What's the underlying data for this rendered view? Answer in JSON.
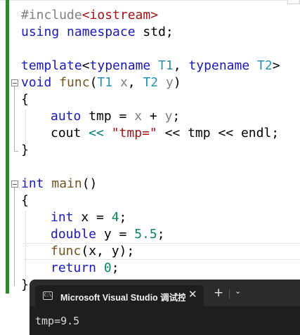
{
  "code": {
    "line1": {
      "p1": "#include",
      "p2": "<iostream>"
    },
    "line2": {
      "k1": "using",
      "s1": " ",
      "k2": "namespace",
      "s2": " std;"
    },
    "line4": {
      "k1": "template",
      "s1": "<",
      "k2": "typename",
      "s2": " ",
      "t1": "T1",
      "s3": ", ",
      "k3": "typename",
      "s4": " ",
      "t2": "T2",
      "s5": ">"
    },
    "line5": {
      "k1": "void",
      "s1": " ",
      "f1": "func",
      "s2": "(",
      "t1": "T1",
      "s3": " ",
      "p1": "x",
      "s4": ", ",
      "t2": "T2",
      "s5": " ",
      "p2": "y",
      "s6": ")"
    },
    "line6": "{",
    "line7": {
      "k1": "auto",
      "s1": " tmp = ",
      "p1": "x",
      "s2": " + ",
      "p2": "y",
      "s3": ";"
    },
    "line8": {
      "s1": "cout ",
      "o1": "<<",
      "s2": " ",
      "str1": "\"tmp=\"",
      "s3": " << tmp << endl;"
    },
    "line9": "}",
    "line11": {
      "k1": "int",
      "s1": " ",
      "f1": "main",
      "s2": "()"
    },
    "line12": "{",
    "line13": {
      "k1": "int",
      "s1": " x = ",
      "n1": "4",
      "s2": ";"
    },
    "line14": {
      "k1": "double",
      "s1": " y = ",
      "n1": "5.5",
      "s2": ";"
    },
    "line15": {
      "f1": "func",
      "s1": "(x, y);"
    },
    "line16": {
      "k1": "return",
      "s1": " ",
      "n1": "0",
      "s2": ";"
    },
    "line17": "}"
  },
  "terminal": {
    "tab_icon_text": "C:\\",
    "tab_title": "Microsoft Visual Studio 调试控制台",
    "close_glyph": "✕",
    "new_tab_glyph": "+",
    "dropdown_glyph": "⌄",
    "output": "tmp=9.5"
  },
  "colors": {
    "keyword": "#1a1ab8",
    "type_param": "#2b91af",
    "string": "#a31515",
    "number": "#098658",
    "change_bar": "#2e8b2e",
    "terminal_bg": "#1e1e1e"
  }
}
